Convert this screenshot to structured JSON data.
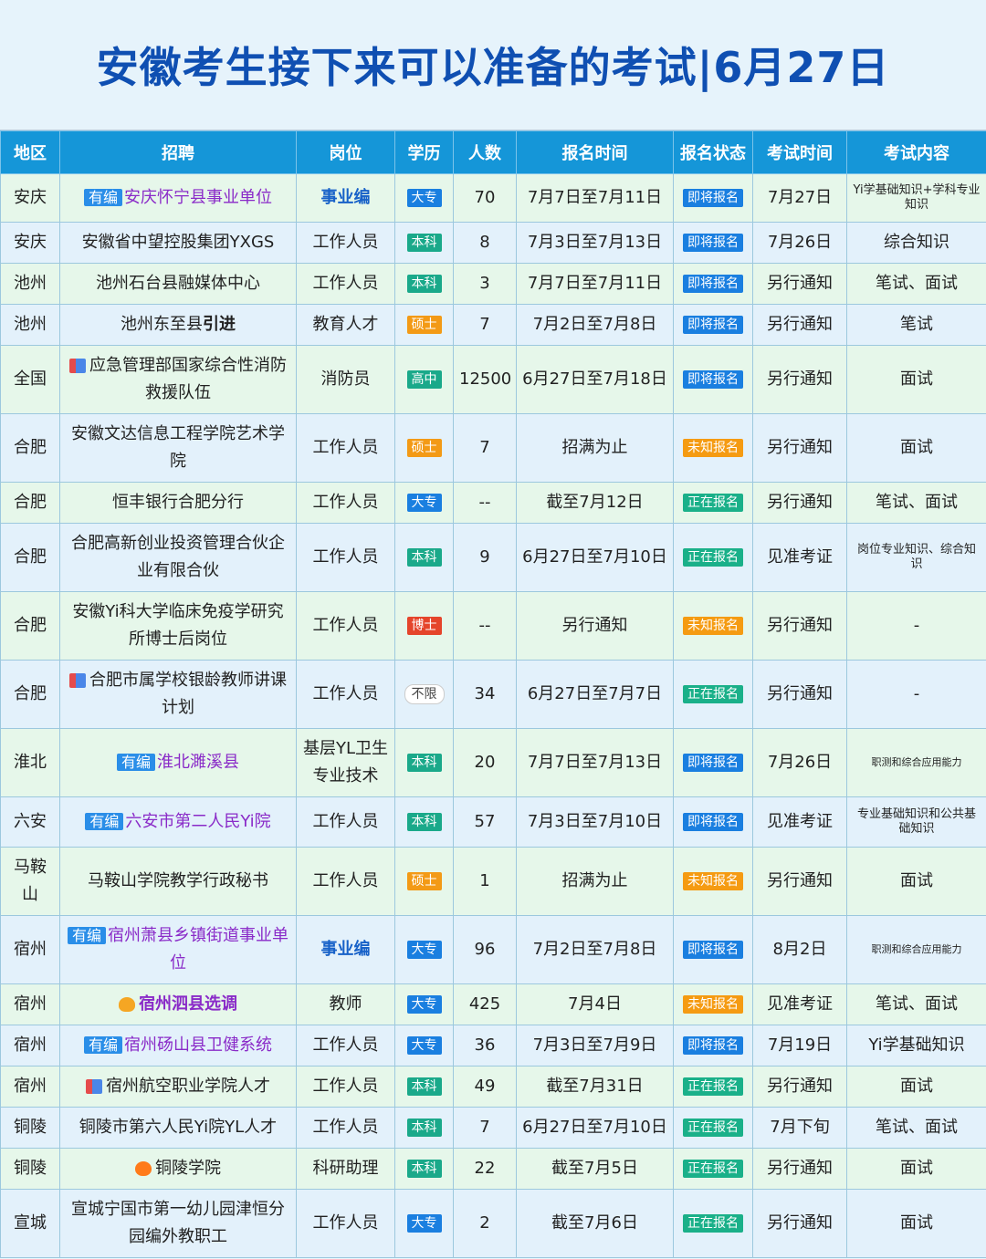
{
  "title": "安徽考生接下来可以准备的考试|6月27日",
  "headers": [
    "地区",
    "招聘",
    "岗位",
    "学历",
    "人数",
    "报名时间",
    "报名状态",
    "考试时间",
    "考试内容"
  ],
  "hire_tag": "有编",
  "rows": [
    {
      "region": "安庆",
      "recruit": "安庆怀宁县事业单位",
      "position": "事业编",
      "edu": "大专",
      "count": "70",
      "reg_time": "7月7日至7月11日",
      "status": "即将报名",
      "exam_time": "7月27日",
      "content": "Yi学基础知识+学科专业知识"
    },
    {
      "region": "安庆",
      "recruit": "安徽省中望控股集团YXGS",
      "position": "工作人员",
      "edu": "本科",
      "count": "8",
      "reg_time": "7月3日至7月13日",
      "status": "即将报名",
      "exam_time": "7月26日",
      "content": "综合知识"
    },
    {
      "region": "池州",
      "recruit": "池州石台县融媒体中心",
      "position": "工作人员",
      "edu": "本科",
      "count": "3",
      "reg_time": "7月7日至7月11日",
      "status": "即将报名",
      "exam_time": "另行通知",
      "content": "笔试、面试"
    },
    {
      "region": "池州",
      "recruit": "池州东至县",
      "recruit_suffix": "引进",
      "position": "教育人才",
      "edu": "硕士",
      "count": "7",
      "reg_time": "7月2日至7月8日",
      "status": "即将报名",
      "exam_time": "另行通知",
      "content": "笔试"
    },
    {
      "region": "全国",
      "recruit": "应急管理部国家综合性消防救援队伍",
      "position": "消防员",
      "edu": "高中",
      "count": "12500",
      "reg_time": "6月27日至7月18日",
      "status": "即将报名",
      "exam_time": "另行通知",
      "content": "面试"
    },
    {
      "region": "合肥",
      "recruit": "安徽文达信息工程学院艺术学院",
      "position": "工作人员",
      "edu": "硕士",
      "count": "7",
      "reg_time": "招满为止",
      "status": "未知报名",
      "exam_time": "另行通知",
      "content": "面试"
    },
    {
      "region": "合肥",
      "recruit": "恒丰银行合肥分行",
      "position": "工作人员",
      "edu": "大专",
      "count": "--",
      "reg_time": "截至7月12日",
      "status": "正在报名",
      "exam_time": "另行通知",
      "content": "笔试、面试"
    },
    {
      "region": "合肥",
      "recruit": "合肥高新创业投资管理合伙企业有限合伙",
      "position": "工作人员",
      "edu": "本科",
      "count": "9",
      "reg_time": "6月27日至7月10日",
      "status": "正在报名",
      "exam_time": "见准考证",
      "content": "岗位专业知识、综合知识"
    },
    {
      "region": "合肥",
      "recruit": "安徽Yi科大学临床免疫学研究所博士后岗位",
      "position": "工作人员",
      "edu": "博士",
      "count": "--",
      "reg_time": "另行通知",
      "status": "未知报名",
      "exam_time": "另行通知",
      "content": "-"
    },
    {
      "region": "合肥",
      "recruit": "合肥市属学校银龄教师讲课计划",
      "position": "工作人员",
      "edu": "不限",
      "count": "34",
      "reg_time": "6月27日至7月7日",
      "status": "正在报名",
      "exam_time": "另行通知",
      "content": "-"
    },
    {
      "region": "淮北",
      "recruit": "淮北濉溪县",
      "position": "基层YL卫生专业技术",
      "edu": "本科",
      "count": "20",
      "reg_time": "7月7日至7月13日",
      "status": "即将报名",
      "exam_time": "7月26日",
      "content": "职测和综合应用能力"
    },
    {
      "region": "六安",
      "recruit": "六安市第二人民Yi院",
      "position": "工作人员",
      "edu": "本科",
      "count": "57",
      "reg_time": "7月3日至7月10日",
      "status": "即将报名",
      "exam_time": "见准考证",
      "content": "专业基础知识和公共基础知识"
    },
    {
      "region": "马鞍山",
      "recruit": "马鞍山学院教学行政秘书",
      "position": "工作人员",
      "edu": "硕士",
      "count": "1",
      "reg_time": "招满为止",
      "status": "未知报名",
      "exam_time": "另行通知",
      "content": "面试"
    },
    {
      "region": "宿州",
      "recruit": "宿州萧县乡镇街道事业单位",
      "position": "事业编",
      "edu": "大专",
      "count": "96",
      "reg_time": "7月2日至7月8日",
      "status": "即将报名",
      "exam_time": "8月2日",
      "content": "职测和综合应用能力"
    },
    {
      "region": "宿州",
      "recruit": "宿州泗县选调",
      "position": "教师",
      "edu": "大专",
      "count": "425",
      "reg_time": "7月4日",
      "status": "未知报名",
      "exam_time": "见准考证",
      "content": "笔试、面试"
    },
    {
      "region": "宿州",
      "recruit": "宿州砀山县卫健系统",
      "position": "工作人员",
      "edu": "大专",
      "count": "36",
      "reg_time": "7月3日至7月9日",
      "status": "即将报名",
      "exam_time": "7月19日",
      "content": "Yi学基础知识"
    },
    {
      "region": "宿州",
      "recruit": "宿州航空职业学院人才",
      "position": "工作人员",
      "edu": "本科",
      "count": "49",
      "reg_time": "截至7月31日",
      "status": "正在报名",
      "exam_time": "另行通知",
      "content": "面试"
    },
    {
      "region": "铜陵",
      "recruit": "铜陵市第六人民Yi院YL人才",
      "position": "工作人员",
      "edu": "本科",
      "count": "7",
      "reg_time": "6月27日至7月10日",
      "status": "正在报名",
      "exam_time": "7月下旬",
      "content": "笔试、面试"
    },
    {
      "region": "铜陵",
      "recruit": "铜陵学院",
      "position": "科研助理",
      "edu": "本科",
      "count": "22",
      "reg_time": "截至7月5日",
      "status": "正在报名",
      "exam_time": "另行通知",
      "content": "面试"
    },
    {
      "region": "宣城",
      "recruit": "宣城宁国市第一幼儿园津恒分园编外教职工",
      "position": "工作人员",
      "edu": "大专",
      "count": "2",
      "reg_time": "截至7月6日",
      "status": "正在报名",
      "exam_time": "另行通知",
      "content": "面试"
    }
  ]
}
